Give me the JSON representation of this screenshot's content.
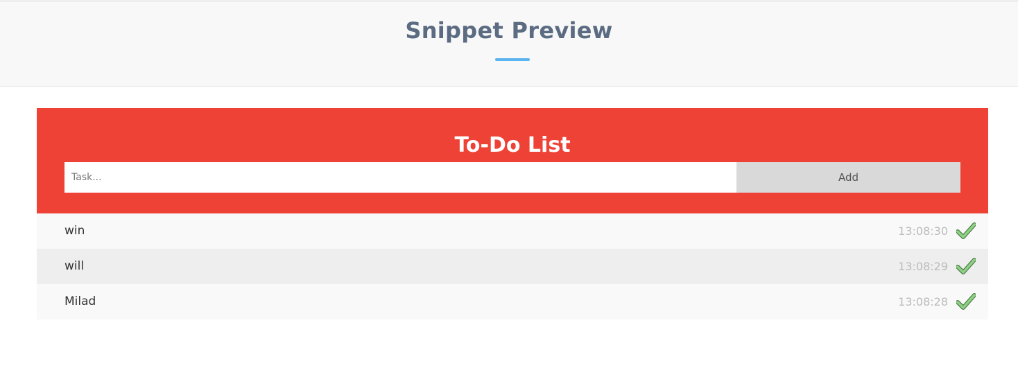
{
  "header": {
    "title": "Snippet Preview",
    "accent_color": "#5bb4f0"
  },
  "todo": {
    "title": "To-Do List",
    "input_placeholder": "Task...",
    "input_value": "",
    "add_label": "Add",
    "panel_color": "#ee4236",
    "items": [
      {
        "text": "win",
        "time": "13:08:30",
        "icon": "check-icon"
      },
      {
        "text": "will",
        "time": "13:08:29",
        "icon": "check-icon"
      },
      {
        "text": "Milad",
        "time": "13:08:28",
        "icon": "check-icon"
      }
    ]
  }
}
